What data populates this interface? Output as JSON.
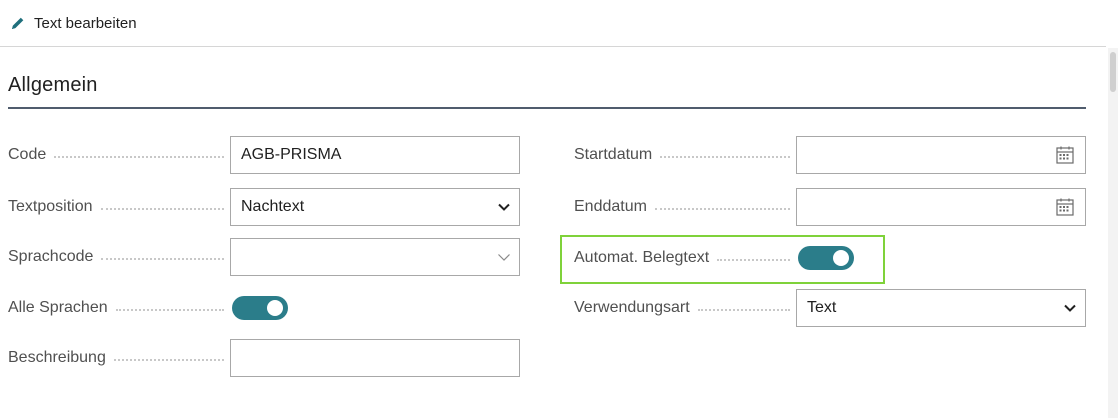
{
  "toolbar": {
    "edit_text_label": "Text bearbeiten"
  },
  "section": {
    "title": "Allgemein"
  },
  "left_fields": {
    "code": {
      "label": "Code",
      "value": "AGB-PRISMA"
    },
    "textposition": {
      "label": "Textposition",
      "value": "Nachtext"
    },
    "sprachcode": {
      "label": "Sprachcode",
      "value": ""
    },
    "alle_sprachen": {
      "label": "Alle Sprachen",
      "checked": true
    },
    "beschreibung": {
      "label": "Beschreibung",
      "value": ""
    }
  },
  "right_fields": {
    "startdatum": {
      "label": "Startdatum",
      "value": ""
    },
    "enddatum": {
      "label": "Enddatum",
      "value": ""
    },
    "automat_belegtext": {
      "label": "Automat. Belegtext",
      "checked": true
    },
    "verwendungsart": {
      "label": "Verwendungsart",
      "value": "Text"
    }
  },
  "colors": {
    "accent": "#2b7d8a",
    "highlight": "#7fd23a",
    "rule": "#505c6d"
  }
}
